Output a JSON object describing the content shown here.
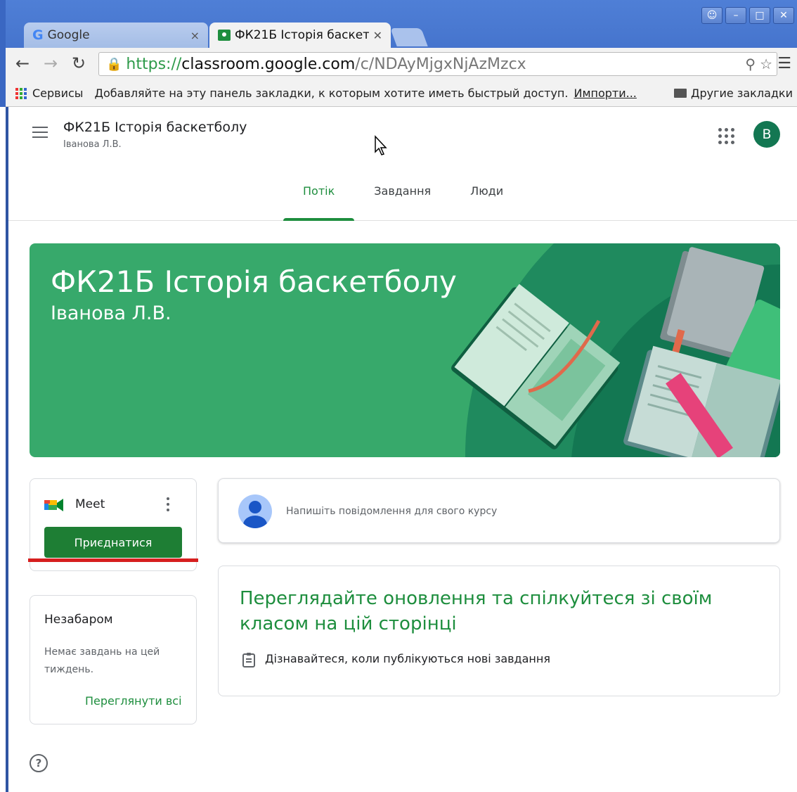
{
  "browser": {
    "tabs": [
      {
        "title": "Google",
        "close": "×"
      },
      {
        "title": "ФК21Б Історія баскет",
        "close": "✕"
      }
    ],
    "url": {
      "scheme": "https://",
      "host": "classroom.google.com",
      "path": "/c/NDAyMjgxNjAzMzcx"
    },
    "bookmarks": {
      "apps": "Сервисы",
      "hint": "Добавляйте на эту панель закладки, к которым хотите иметь быстрый доступ.",
      "import": "Импорти...",
      "other": "Другие закладки"
    }
  },
  "header": {
    "course_title": "ФК21Б Історія баскетболу",
    "teacher": "Іванова Л.В.",
    "avatar_letter": "В",
    "tabs": [
      {
        "label": "Потік",
        "active": true
      },
      {
        "label": "Завдання",
        "active": false
      },
      {
        "label": "Люди",
        "active": false
      }
    ]
  },
  "banner": {
    "title": "ФК21Б Історія баскетболу",
    "subtitle": "Іванова Л.В.",
    "color": "#37a96b"
  },
  "meet": {
    "label": "Meet",
    "join_label": "Приєднатися"
  },
  "post": {
    "placeholder": "Напишіть повідомлення для свого курсу"
  },
  "upcoming": {
    "title": "Незабаром",
    "empty_text": "Немає завдань на цей тиждень.",
    "view_all": "Переглянути всі"
  },
  "info": {
    "title": "Переглядайте оновлення та спілкуйтеся зі своїм класом на цій сторінці",
    "text": "Дізнавайтеся, коли публікуються нові завдання"
  },
  "help": {
    "symbol": "?"
  },
  "colors": {
    "accent": "#1e8e3e",
    "highlight": "#d61f1f"
  }
}
